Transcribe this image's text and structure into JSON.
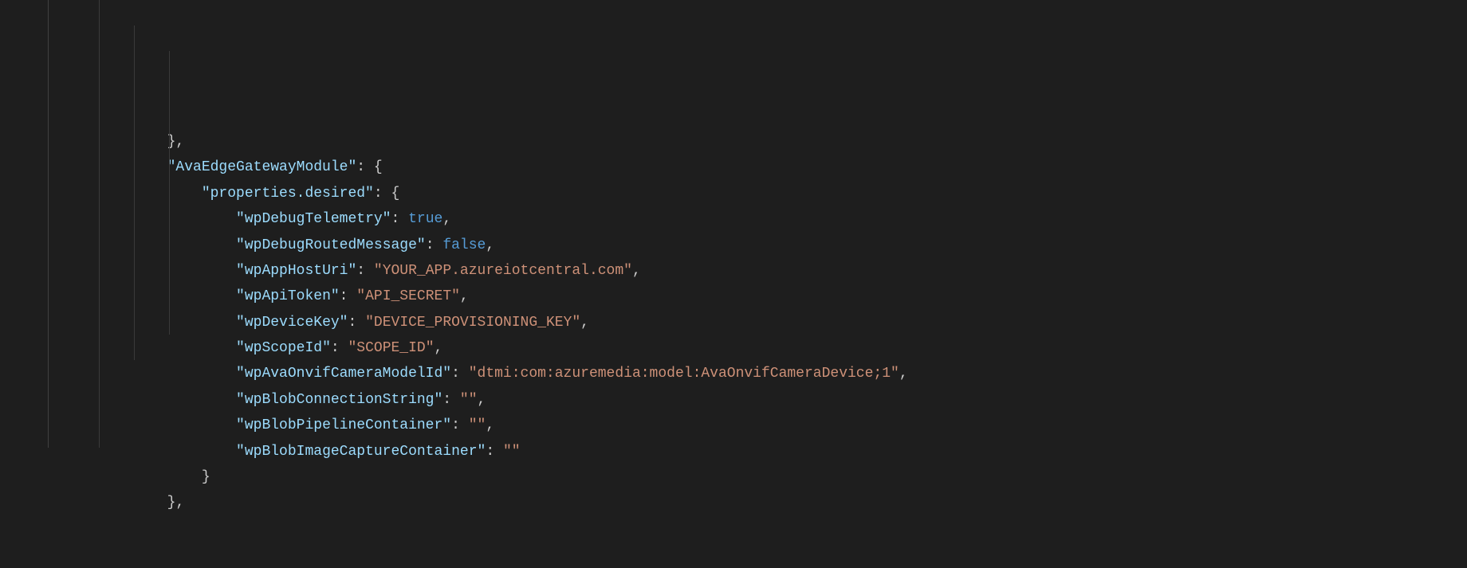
{
  "code": {
    "line0_closing": "},",
    "module_key": "\"AvaEdgeGatewayModule\"",
    "colon": ":",
    "space": " ",
    "brace_open": "{",
    "brace_close": "}",
    "comma": ",",
    "properties_desired_key": "\"properties.desired\"",
    "keys": {
      "wpDebugTelemetry": "\"wpDebugTelemetry\"",
      "wpDebugRoutedMessage": "\"wpDebugRoutedMessage\"",
      "wpAppHostUri": "\"wpAppHostUri\"",
      "wpApiToken": "\"wpApiToken\"",
      "wpDeviceKey": "\"wpDeviceKey\"",
      "wpScopeId": "\"wpScopeId\"",
      "wpAvaOnvifCameraModelId": "\"wpAvaOnvifCameraModelId\"",
      "wpBlobConnectionString": "\"wpBlobConnectionString\"",
      "wpBlobPipelineContainer": "\"wpBlobPipelineContainer\"",
      "wpBlobImageCaptureContainer": "\"wpBlobImageCaptureContainer\""
    },
    "values": {
      "true": "true",
      "false": "false",
      "wpAppHostUri": "\"YOUR_APP.azureiotcentral.com\"",
      "wpApiToken": "\"API_SECRET\"",
      "wpDeviceKey": "\"DEVICE_PROVISIONING_KEY\"",
      "wpScopeId": "\"SCOPE_ID\"",
      "wpAvaOnvifCameraModelId": "\"dtmi:com:azuremedia:model:AvaOnvifCameraDevice;1\"",
      "wpBlobConnectionString": "\"\"",
      "wpBlobPipelineContainer": "\"\"",
      "wpBlobImageCaptureContainer": "\"\""
    },
    "indent1": "        ",
    "indent2": "            ",
    "indent3": "                ",
    "indent4": "                    "
  }
}
